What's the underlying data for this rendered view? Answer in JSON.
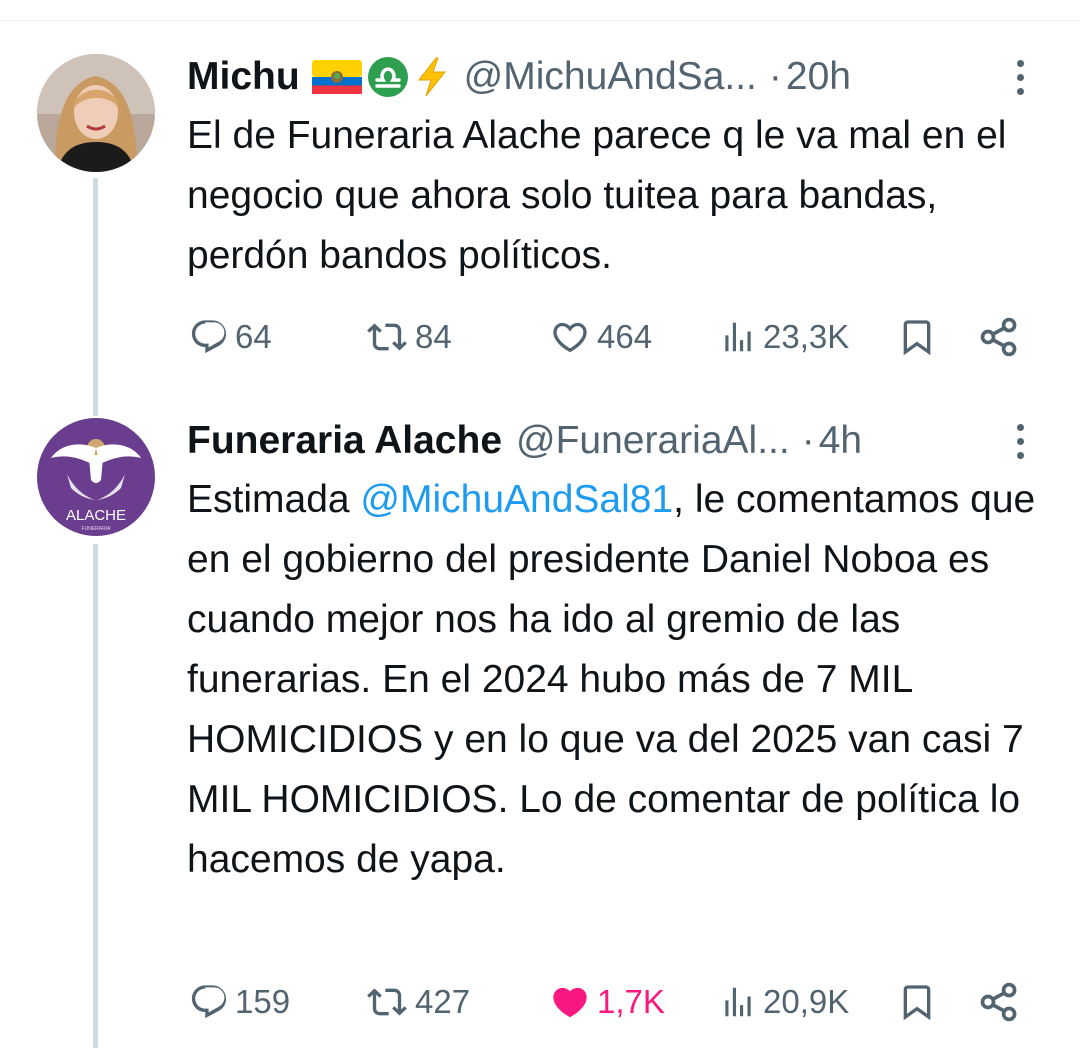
{
  "tweets": [
    {
      "display_name": "Michu",
      "badges": [
        "ecuador-flag",
        "libra-symbol",
        "lightning"
      ],
      "handle": "@MichuAndSa...",
      "separator": "·",
      "time": "20h",
      "text": "El de Funeraria Alache parece q le va mal en el negocio que ahora solo tuitea para bandas,  perdón bandos políticos.",
      "stats": {
        "replies": "64",
        "reposts": "84",
        "likes": "464",
        "views": "23,3K"
      },
      "liked": false
    },
    {
      "display_name": "Funeraria Alache",
      "avatar_logo_text": "ALACHE",
      "avatar_logo_subtext": "FUNERARIA",
      "handle": "@FunerariaAl...",
      "separator": "·",
      "time": "4h",
      "text_before_mention": "Estimada ",
      "mention": "@MichuAndSal81",
      "text_after_mention": ", le comentamos que en el gobierno del presidente Daniel Noboa es cuando mejor nos ha ido al gremio de las funerarias. En el 2024 hubo más de 7 MIL HOMICIDIOS y en lo que va del 2025 van casi 7 MIL HOMICIDIOS. Lo de comentar de política lo hacemos de yapa.",
      "stats": {
        "replies": "159",
        "reposts": "427",
        "likes": "1,7K",
        "views": "20,9K"
      },
      "liked": true
    }
  ],
  "colors": {
    "text": "#0f1419",
    "secondary": "#536471",
    "link": "#1d9bf0",
    "like_active": "#f91880",
    "thread_line": "#cfd9de",
    "alache_purple": "#6a3d8f"
  }
}
